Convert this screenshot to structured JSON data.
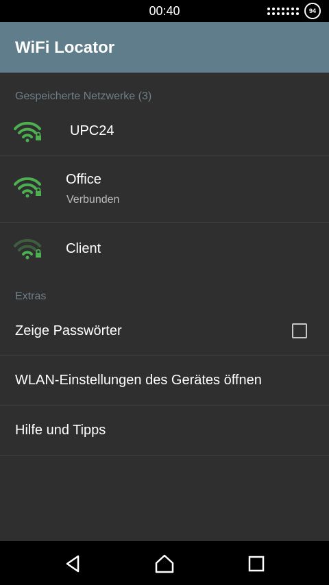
{
  "status_bar": {
    "time": "00:40",
    "battery": "94"
  },
  "app_bar": {
    "title": "WiFi Locator"
  },
  "saved_networks": {
    "header": "Gespeicherte Netzwerke (3)",
    "items": [
      {
        "ssid": "UPC24",
        "status": "",
        "icon": "wifi-lock-icon"
      },
      {
        "ssid": "Office",
        "status": "Verbunden",
        "icon": "wifi-lock-icon"
      },
      {
        "ssid": "Client",
        "status": "",
        "icon": "wifi-lock-icon"
      }
    ]
  },
  "extras": {
    "header": "Extras",
    "show_passwords_label": "Zeige Passwörter",
    "show_passwords_checked": false,
    "wlan_settings_label": "WLAN-Einstellungen des Gerätes öffnen",
    "help_label": "Hilfe und Tipps"
  },
  "colors": {
    "app_bar": "#607d8b",
    "background": "#2f2f2f",
    "wifi_green": "#4caf50",
    "section_header": "#6f7f88"
  },
  "nav_bar": {
    "icons": [
      "back-icon",
      "home-icon",
      "recents-icon"
    ]
  }
}
